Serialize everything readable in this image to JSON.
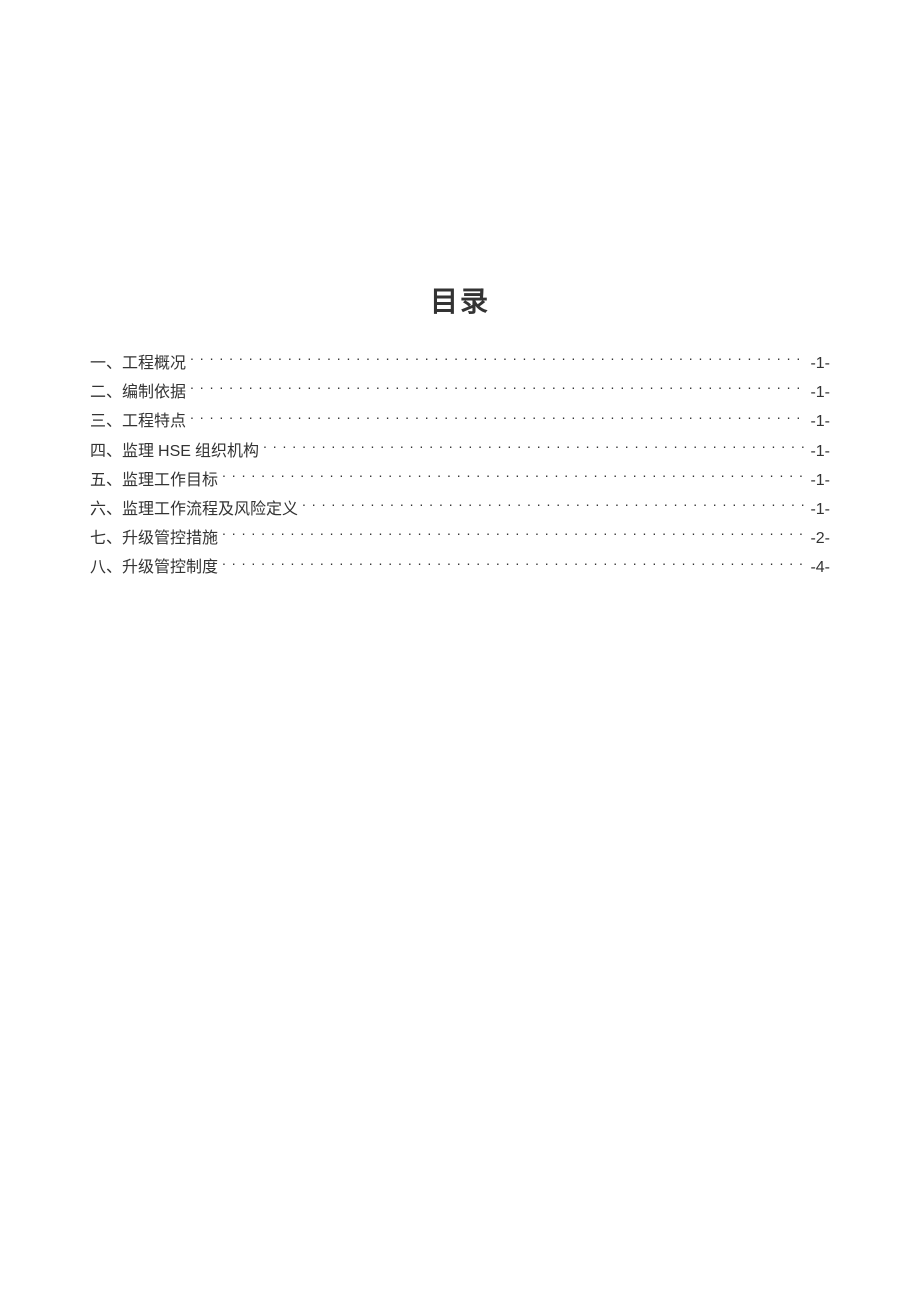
{
  "title": "目录",
  "toc": [
    {
      "label_prefix": "一、",
      "label_text": "工程概况",
      "page": "-1-"
    },
    {
      "label_prefix": "二、",
      "label_text": "编制依据",
      "page": "-1-"
    },
    {
      "label_prefix": "三、",
      "label_text": "工程特点",
      "page": "-1-"
    },
    {
      "label_prefix": "四、",
      "label_text": "监理 HSE 组织机构",
      "page": "-1-"
    },
    {
      "label_prefix": "五、",
      "label_text": "监理工作目标",
      "page": "-1-"
    },
    {
      "label_prefix": "六、",
      "label_text": "监理工作流程及风险定义",
      "page": "-1-"
    },
    {
      "label_prefix": "七、",
      "label_text": "升级管控措施",
      "page": "-2-"
    },
    {
      "label_prefix": "八、",
      "label_text": "升级管控制度",
      "page": "-4-"
    }
  ]
}
